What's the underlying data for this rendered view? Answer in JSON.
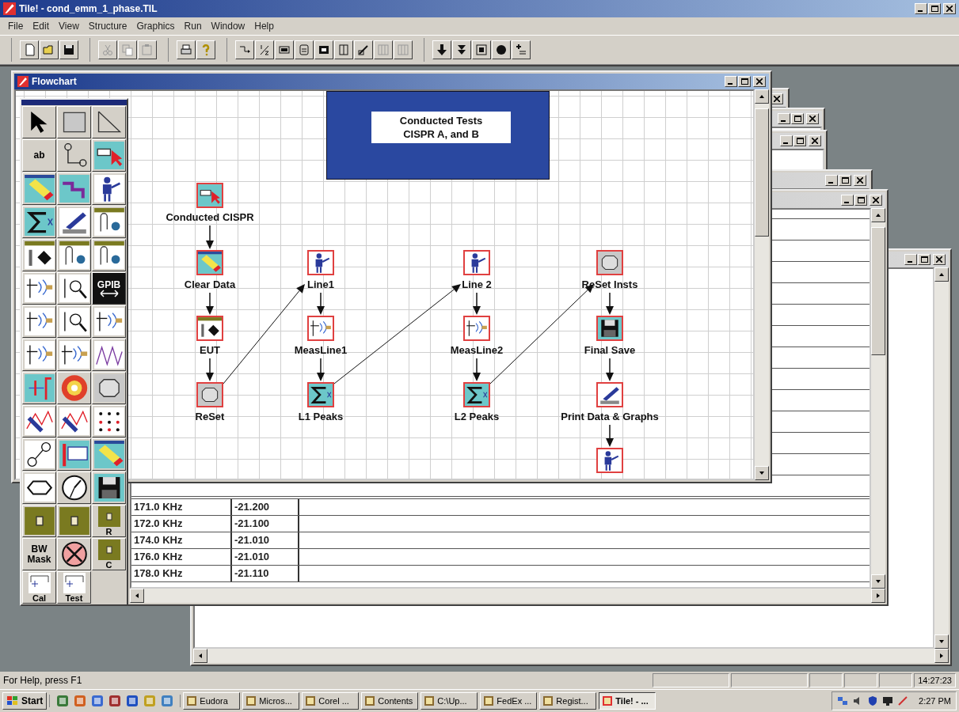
{
  "window": {
    "title": "Tile! - cond_emm_1_phase.TIL"
  },
  "menu": [
    "File",
    "Edit",
    "View",
    "Structure",
    "Graphics",
    "Run",
    "Window",
    "Help"
  ],
  "toolbar": [
    [
      {
        "kind": "new",
        "disabled": false
      },
      {
        "kind": "open",
        "disabled": false
      },
      {
        "kind": "save",
        "disabled": false
      }
    ],
    [
      {
        "kind": "cut",
        "disabled": true
      },
      {
        "kind": "copy",
        "disabled": true
      },
      {
        "kind": "paste",
        "disabled": true
      }
    ],
    [
      {
        "kind": "print",
        "disabled": false
      },
      {
        "kind": "help",
        "disabled": false
      }
    ],
    [
      {
        "kind": "step",
        "disabled": false
      },
      {
        "kind": "fraction",
        "disabled": false
      },
      {
        "kind": "chip",
        "disabled": false
      },
      {
        "kind": "form",
        "disabled": false
      },
      {
        "kind": "block",
        "disabled": false
      },
      {
        "kind": "columns",
        "disabled": false
      },
      {
        "kind": "pencil",
        "disabled": false
      },
      {
        "kind": "grid",
        "disabled": true
      },
      {
        "kind": "grid",
        "disabled": true
      }
    ],
    [
      {
        "kind": "down",
        "disabled": false
      },
      {
        "kind": "double-down",
        "disabled": false
      },
      {
        "kind": "target",
        "disabled": false
      },
      {
        "kind": "dot",
        "disabled": false
      },
      {
        "kind": "list",
        "disabled": false
      }
    ]
  ],
  "flowchart_window": {
    "title": "Flowchart",
    "banner": [
      "Conducted Tests",
      "CISPR A, and B"
    ],
    "columns": [
      {
        "nodes": [
          {
            "label": "Conducted CISPR",
            "kind": "panel"
          },
          {
            "label": "Clear Data",
            "kind": "eraser"
          },
          {
            "label": "EUT",
            "kind": "eut"
          },
          {
            "label": "ReSet",
            "kind": "frame"
          }
        ]
      },
      {
        "nodes": [
          {
            "label": "Line1",
            "kind": "person"
          },
          {
            "label": "MeasLine1",
            "kind": "antenna"
          },
          {
            "label": "L1 Peaks",
            "kind": "sigma"
          }
        ]
      },
      {
        "nodes": [
          {
            "label": "Line 2",
            "kind": "person"
          },
          {
            "label": "MeasLine2",
            "kind": "antenna"
          },
          {
            "label": "L2 Peaks",
            "kind": "sigma"
          }
        ]
      },
      {
        "nodes": [
          {
            "label": "ReSet Insts",
            "kind": "frame"
          },
          {
            "label": "Final Save",
            "kind": "disk"
          },
          {
            "label": "Print Data & Graphs",
            "kind": "plotter"
          },
          {
            "kind": "person"
          }
        ]
      }
    ]
  },
  "palette": {
    "tools": [
      {
        "kind": "pointer"
      },
      {
        "kind": "box"
      },
      {
        "kind": "slope"
      },
      {
        "kind": "text",
        "label": "ab"
      },
      {
        "kind": "connector"
      },
      {
        "kind": "panel"
      },
      {
        "kind": "eraser"
      },
      {
        "kind": "flow"
      },
      {
        "kind": "person"
      },
      {
        "kind": "sigma"
      },
      {
        "kind": "plotter"
      },
      {
        "kind": "clip"
      },
      {
        "kind": "eut"
      },
      {
        "kind": "clip"
      },
      {
        "kind": "clip"
      },
      {
        "kind": "antenna"
      },
      {
        "kind": "probe"
      },
      {
        "kind": "gpib",
        "label": "GPIB"
      },
      {
        "kind": "antenna"
      },
      {
        "kind": "probe"
      },
      {
        "kind": "antenna"
      },
      {
        "kind": "antenna"
      },
      {
        "kind": "antenna"
      },
      {
        "kind": "waves"
      },
      {
        "kind": "bars"
      },
      {
        "kind": "wheel"
      },
      {
        "kind": "frame"
      },
      {
        "kind": "pen"
      },
      {
        "kind": "pen"
      },
      {
        "kind": "dots"
      },
      {
        "kind": "nodes"
      },
      {
        "kind": "window"
      },
      {
        "kind": "eraser"
      },
      {
        "kind": "oval"
      },
      {
        "kind": "gauge"
      },
      {
        "kind": "disk"
      },
      {
        "kind": "olive"
      },
      {
        "kind": "olive"
      },
      {
        "kind": "olive-label",
        "label": "R"
      },
      {
        "kind": "text",
        "label": "BW Mask"
      },
      {
        "kind": "cross"
      },
      {
        "kind": "olive-label",
        "label": "C"
      },
      {
        "kind": "circuit-label",
        "label": "Cal"
      },
      {
        "kind": "circuit-label",
        "label": "Test"
      }
    ]
  },
  "data_table": {
    "rows": [
      {
        "frequency": "171.0 KHz",
        "value": "-21.200"
      },
      {
        "frequency": "172.0 KHz",
        "value": "-21.100"
      },
      {
        "frequency": "174.0 KHz",
        "value": "-21.010"
      },
      {
        "frequency": "176.0 KHz",
        "value": "-21.010"
      },
      {
        "frequency": "178.0 KHz",
        "value": "-21.110"
      }
    ]
  },
  "status_bar": {
    "text": "For Help, press F1",
    "time": "14:27:23"
  },
  "taskbar": {
    "start": "Start",
    "tasks": [
      {
        "label": "Eudora",
        "selected": false
      },
      {
        "label": "Micros...",
        "selected": false
      },
      {
        "label": "Corel ...",
        "selected": false
      },
      {
        "label": "Contents",
        "selected": false
      },
      {
        "label": "C:\\Up...",
        "selected": false
      },
      {
        "label": "FedEx ...",
        "selected": false
      },
      {
        "label": "Regist...",
        "selected": false
      },
      {
        "label": "Tile! - ...",
        "selected": true
      }
    ],
    "clock": "2:27 PM"
  }
}
